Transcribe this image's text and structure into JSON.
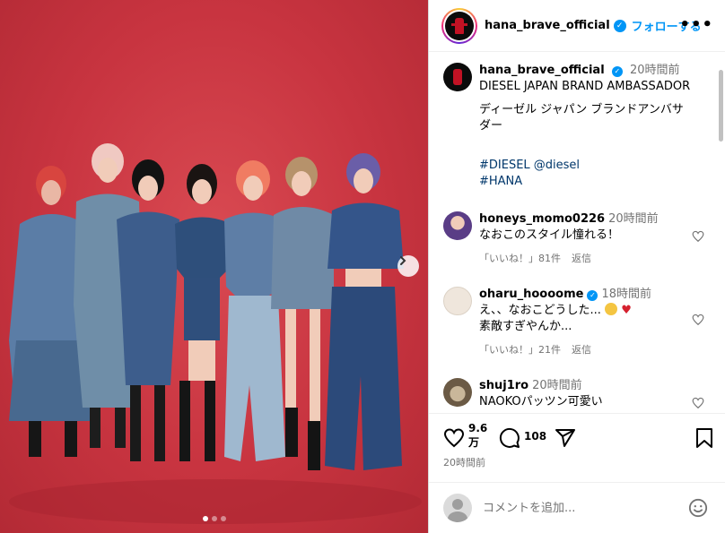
{
  "post": {
    "username": "hana_brave_official",
    "follow_label": "フォローする",
    "more_label": "•••"
  },
  "caption": {
    "username": "hana_brave_official",
    "time": "20時間前",
    "line1": "DIESEL JAPAN BRAND AMBASSADOR",
    "line2a": "ディーゼル ジャパン ブランドアンバサ",
    "line2b": "ダー",
    "tag1": "#DIESEL @diesel",
    "tag2": "#HANA"
  },
  "comments": [
    {
      "user": "honeys_momo0226",
      "time": "20時間前",
      "text": "なおこのスタイル憧れる！",
      "likes": "「いいね！」81件",
      "reply": "返信"
    },
    {
      "user": "oharu_hoooome",
      "time": "18時間前",
      "text1": "え、、なおこどうした...",
      "text2": "素敵すぎやんか...",
      "likes": "「いいね！」21件",
      "reply": "返信"
    },
    {
      "user": "shuj1ro",
      "time": "20時間前",
      "text": "NAOKOパッツン可愛い"
    }
  ],
  "actions": {
    "likes_1": "9.6",
    "likes_2": "万",
    "comments_count": "108",
    "posted": "20時間前"
  },
  "composer": {
    "placeholder": "コメントを追加..."
  },
  "colors": {
    "link_blue": "#0095f6",
    "tag_blue": "#00376b",
    "bg_red": "#c83440"
  },
  "icons": [
    "verified-badge-icon",
    "more-icon",
    "chevron-right-icon",
    "heart-icon",
    "comment-icon",
    "share-icon",
    "bookmark-icon",
    "emoji-icon"
  ]
}
